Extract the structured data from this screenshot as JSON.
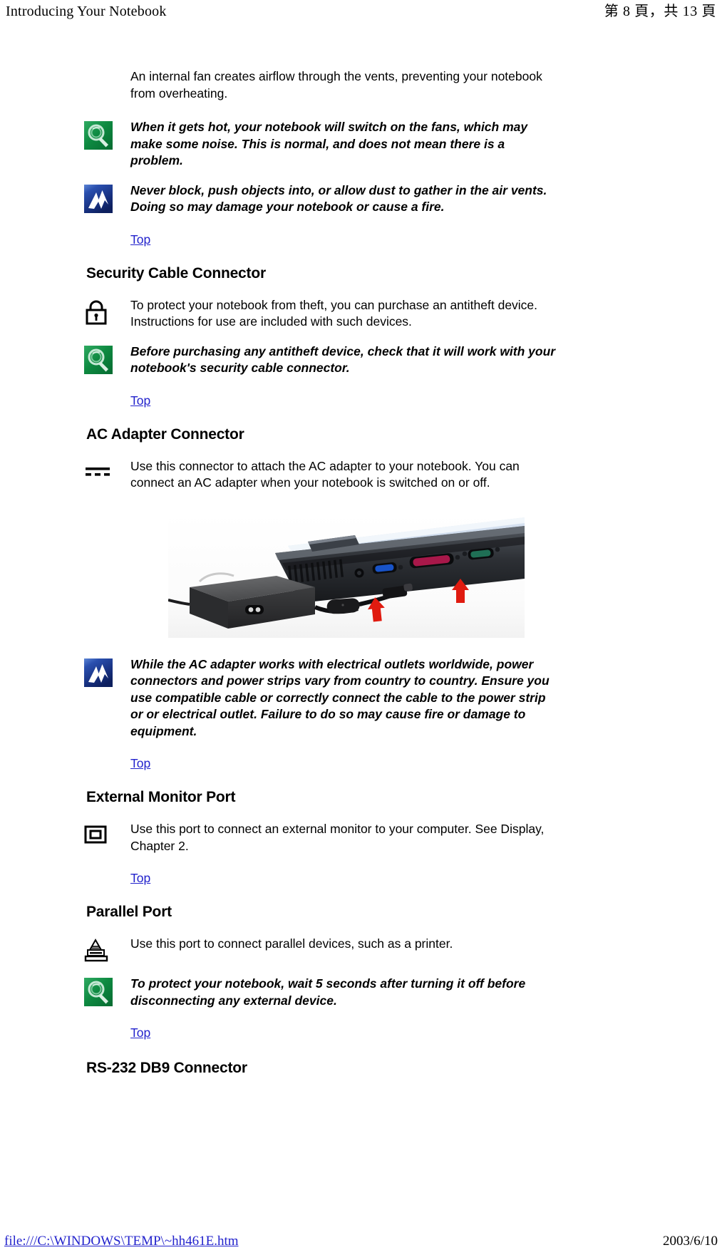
{
  "header": {
    "left_title": "Introducing Your Notebook",
    "right_page_indicator": "第 8 頁，共 13 頁"
  },
  "footer": {
    "file_path": "file:///C:\\WINDOWS\\TEMP\\~hh461E.htm",
    "date": "2003/6/10"
  },
  "link_labels": {
    "top": "Top"
  },
  "icons": {
    "note": "note-tip-icon",
    "warning": "warning-lightning-icon",
    "lock": "padlock-icon",
    "dc_power": "dc-power-connector-icon",
    "monitor": "external-monitor-icon",
    "printer": "printer-parallel-icon"
  },
  "colors": {
    "note_green": "#0f8a42",
    "warning_blue": "#1b3f9e",
    "link_blue": "#2222cc",
    "arrow_red": "#e01b10",
    "text_black": "#000000"
  },
  "body": {
    "fan_paragraph": "An internal fan creates airflow through the vents, preventing your notebook from overheating.",
    "fan_note": "When it gets hot, your notebook will switch on the fans, which may make some noise. This is normal, and does not mean there is a problem.",
    "fan_warning": "Never block, push objects into, or allow dust to gather in the air vents. Doing so may damage your notebook or cause a fire."
  },
  "sections": [
    {
      "title": "Security Cable Connector",
      "body": "To protect your notebook from theft, you can purchase an antitheft device. Instructions for use are included with such devices.",
      "note": "Before purchasing any antitheft device, check that it will work with your notebook's security cable connector."
    },
    {
      "title": "AC Adapter Connector",
      "body": "Use this connector to attach the AC adapter to your notebook. You can connect an AC adapter when your notebook is switched on or off.",
      "warning": "While the AC adapter works with electrical outlets worldwide, power connectors and power strips vary from country to country. Ensure you use compatible cable or correctly connect the cable to the power strip or or electrical outlet. Failure to do so may cause fire or damage to equipment."
    },
    {
      "title": "External Monitor Port",
      "body": "Use this port to connect an external monitor to your computer. See Display, Chapter 2."
    },
    {
      "title": "Parallel Port",
      "body": "Use this port to connect parallel devices, such as a printer.",
      "note": "To protect your notebook, wait 5 seconds after turning it off before disconnecting any external device."
    },
    {
      "title": "RS-232 DB9 Connector"
    }
  ],
  "photo": {
    "alt": "AC adapter brick connected by cable to the rear port panel of a notebook computer, with red arrows indicating the two cable connection points."
  }
}
